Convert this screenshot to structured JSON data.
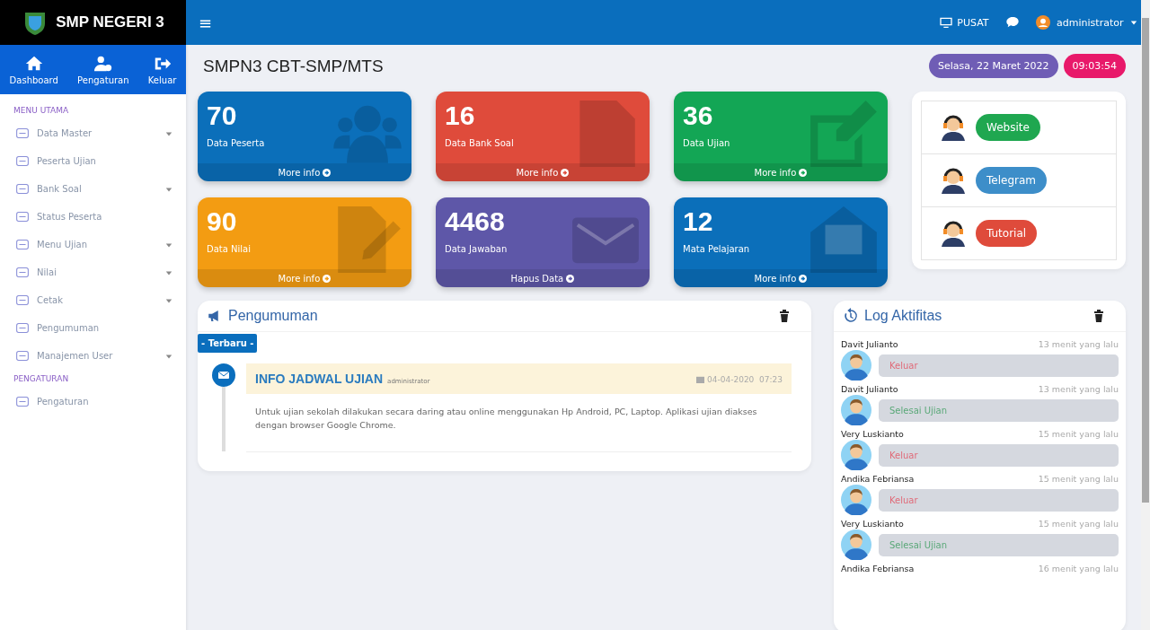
{
  "brand": {
    "title": "SMP NEGERI 3"
  },
  "quick_nav": [
    {
      "label": "Dashboard"
    },
    {
      "label": "Pengaturan"
    },
    {
      "label": "Keluar"
    }
  ],
  "sidebar": {
    "sections": [
      {
        "heading": "MENU UTAMA",
        "items": [
          {
            "label": "Data Master",
            "kind": "submenu"
          },
          {
            "label": "Peserta Ujian",
            "kind": "link"
          },
          {
            "label": "Bank Soal",
            "kind": "submenu"
          },
          {
            "label": "Status Peserta",
            "kind": "link"
          },
          {
            "label": "Menu Ujian",
            "kind": "submenu"
          },
          {
            "label": "Nilai",
            "kind": "submenu"
          },
          {
            "label": "Cetak",
            "kind": "submenu"
          },
          {
            "label": "Pengumuman",
            "kind": "link"
          },
          {
            "label": "Manajemen User",
            "kind": "submenu"
          }
        ]
      },
      {
        "heading": "PENGATURAN",
        "items": [
          {
            "label": "Pengaturan",
            "kind": "link"
          }
        ]
      }
    ]
  },
  "topbar": {
    "menu_glyph": "≡",
    "server": "PUSAT",
    "user": "administrator"
  },
  "page_title": "SMPN3 CBT-SMP/MTS",
  "date_badge": "Selasa, 22 Maret 2022",
  "time_badge": "09:03:54",
  "stat_cards": [
    {
      "value": "70",
      "label": "Data Peserta",
      "link": "More info",
      "color": "#0b6fba"
    },
    {
      "value": "16",
      "label": "Data Bank Soal",
      "link": "More info",
      "color": "#df4b3b"
    },
    {
      "value": "36",
      "label": "Data Ujian",
      "link": "More info",
      "color": "#13a655"
    },
    {
      "value": "90",
      "label": "Data Nilai",
      "link": "More info",
      "color": "#f39c12"
    },
    {
      "value": "4468",
      "label": "Data Jawaban",
      "link": "Hapus Data",
      "color": "#5e57a8"
    },
    {
      "value": "12",
      "label": "Mata Pelajaran",
      "link": "More info",
      "color": "#0b6fba"
    }
  ],
  "contact_links": [
    {
      "label": "Website",
      "color": "#1fa750"
    },
    {
      "label": "Telegram",
      "color": "#3d8ec9"
    },
    {
      "label": "Tutorial",
      "color": "#df4b3b"
    }
  ],
  "announcements": {
    "title": "Pengumuman",
    "badge": "- Terbaru -",
    "items": [
      {
        "title": "INFO JADWAL UJIAN",
        "author": "administrator",
        "date": "04-04-2020  07:23",
        "body": "Untuk ujian sekolah dilakukan secara daring atau online menggunakan Hp Android, PC, Laptop. Aplikasi ujian diakses dengan browser Google Chrome."
      }
    ]
  },
  "activity_log": {
    "title": "Log Aktifitas",
    "entries": [
      {
        "name": "Davit Julianto",
        "time": "13 menit yang lalu",
        "action": "Keluar",
        "kind": "logout"
      },
      {
        "name": "Davit Julianto",
        "time": "13 menit yang lalu",
        "action": "Selesai Ujian",
        "kind": "finish"
      },
      {
        "name": "Very Luskianto",
        "time": "15 menit yang lalu",
        "action": "Keluar",
        "kind": "logout"
      },
      {
        "name": "Andika Febriansa",
        "time": "15 menit yang lalu",
        "action": "Keluar",
        "kind": "logout"
      },
      {
        "name": "Very Luskianto",
        "time": "15 menit yang lalu",
        "action": "Selesai Ujian",
        "kind": "finish"
      },
      {
        "name": "Andika Febriansa",
        "time": "16 menit yang lalu"
      }
    ]
  }
}
